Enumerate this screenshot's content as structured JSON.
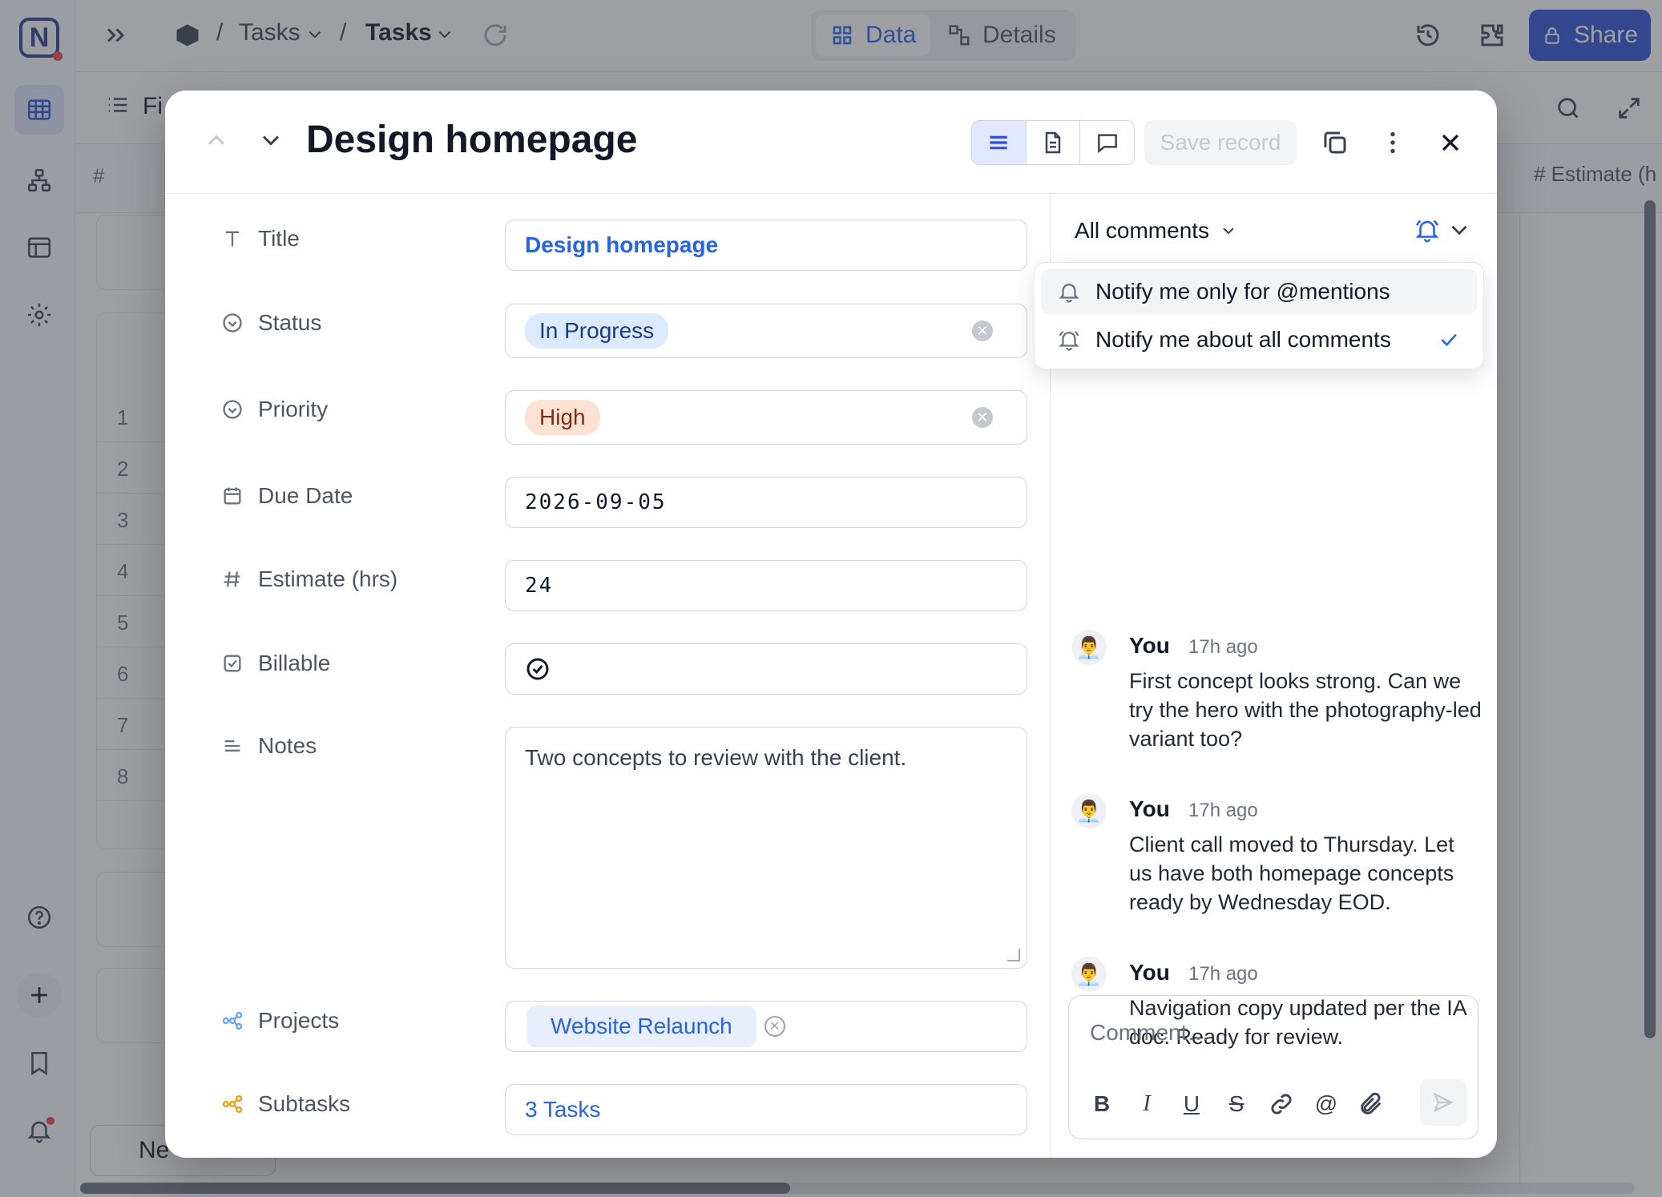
{
  "topbar": {
    "crumb1": "Tasks",
    "crumb2": "Tasks",
    "sep": "/",
    "tab_data": "Data",
    "tab_details": "Details",
    "share_label": "Share"
  },
  "background": {
    "toolbar_fields_partial": "Fi",
    "col_hash": "#",
    "col_estimate_partial": "# Estimate (h",
    "row_numbers": [
      "1",
      "2",
      "3",
      "4",
      "5",
      "6",
      "7",
      "8"
    ],
    "new_partial": "Ne"
  },
  "record": {
    "title": "Design homepage",
    "save_label": "Save record",
    "fields": {
      "title_label": "Title",
      "title_value": "Design homepage",
      "status_label": "Status",
      "status_value": "In Progress",
      "priority_label": "Priority",
      "priority_value": "High",
      "due_label": "Due Date",
      "due_value": "2026-09-05",
      "estimate_label": "Estimate (hrs)",
      "estimate_value": "24",
      "billable_label": "Billable",
      "notes_label": "Notes",
      "notes_value": "Two concepts to review with the client.",
      "projects_label": "Projects",
      "projects_value": "Website Relaunch",
      "subtasks_label": "Subtasks",
      "subtasks_value": "3 Tasks"
    }
  },
  "comments": {
    "filter_label": "All comments",
    "dropdown": {
      "opt_mentions": "Notify me only for @mentions",
      "opt_all": "Notify me about all comments",
      "selected": "Notify me about all comments"
    },
    "items": [
      {
        "author": "You",
        "time": "17h ago",
        "body": "First concept looks strong. Can we try the hero with the photography-led variant too?"
      },
      {
        "author": "You",
        "time": "17h ago",
        "body": "Client call moved to Thursday. Let us have both homepage concepts ready by Wednesday EOD."
      },
      {
        "author": "You",
        "time": "17h ago",
        "body": "Navigation copy updated per the IA doc. Ready for review."
      }
    ],
    "input_placeholder": "Comment…"
  },
  "colors": {
    "accent": "#2563eb",
    "share_bg": "#2b4fd6",
    "status_pill": "#dbeafe",
    "priority_pill": "#fde1d3"
  }
}
